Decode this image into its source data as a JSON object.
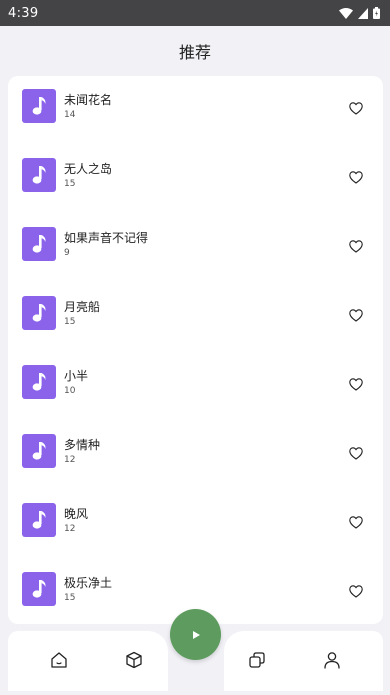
{
  "status_bar": {
    "time": "4:39",
    "icons": [
      "wifi-icon",
      "signal-icon",
      "battery-icon"
    ]
  },
  "header": {
    "title": "推荐"
  },
  "songs": [
    {
      "title": "未闻花名",
      "count": "14"
    },
    {
      "title": "无人之岛",
      "count": "15"
    },
    {
      "title": "如果声音不记得",
      "count": "9"
    },
    {
      "title": "月亮船",
      "count": "15"
    },
    {
      "title": "小半",
      "count": "10"
    },
    {
      "title": "多情种",
      "count": "12"
    },
    {
      "title": "晚风",
      "count": "12"
    },
    {
      "title": "极乐净土",
      "count": "15"
    }
  ],
  "bottom_nav": {
    "items": [
      "home-icon",
      "cube-icon",
      "play-icon",
      "cards-icon",
      "profile-icon"
    ]
  },
  "colors": {
    "status_bar": "#444446",
    "background": "#f1f1f6",
    "cover": "#8a63ea",
    "play_button": "#5d9b5e"
  }
}
